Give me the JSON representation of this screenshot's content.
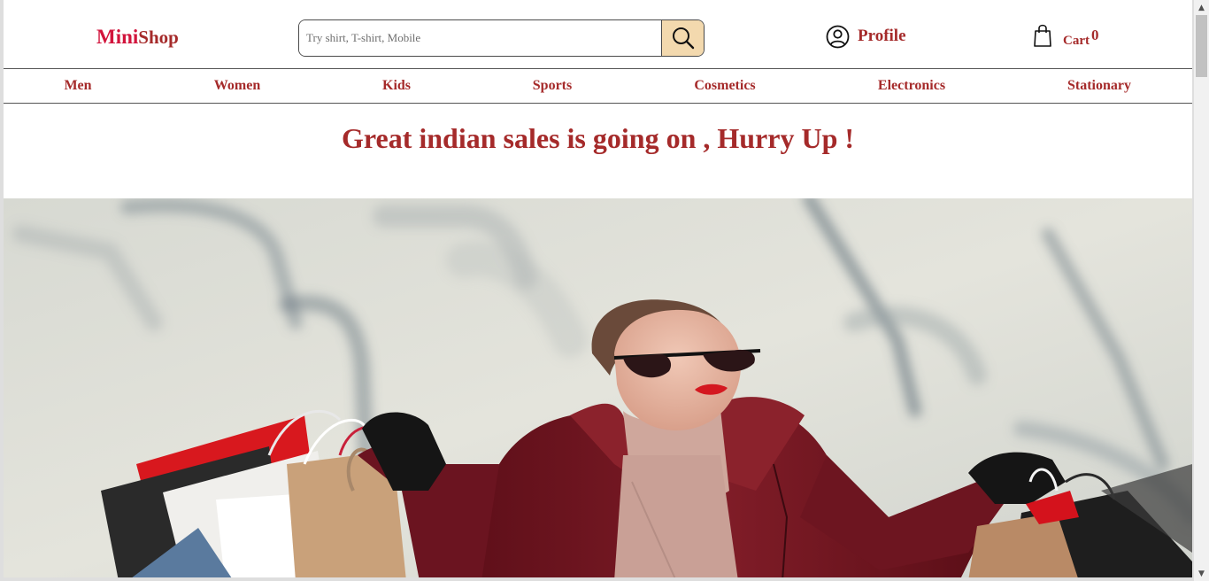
{
  "header": {
    "logo_first": "Mini",
    "logo_second": "Shop",
    "search_placeholder": "Try shirt, T-shirt, Mobile",
    "search_icon": "search-icon",
    "profile_label": "Profile",
    "profile_icon": "user-circle-icon",
    "cart_label": "Cart",
    "cart_count": "0",
    "cart_icon": "shopping-bag-icon"
  },
  "nav": {
    "items": [
      {
        "label": "Men"
      },
      {
        "label": "Women"
      },
      {
        "label": "Kids"
      },
      {
        "label": "Sports"
      },
      {
        "label": "Cosmetics"
      },
      {
        "label": "Electronics"
      },
      {
        "label": "Stationary"
      }
    ]
  },
  "banner": {
    "text": "Great indian sales is going on , Hurry Up !"
  },
  "colors": {
    "brand_red": "#d2143c",
    "accent_brown": "#a52a2a",
    "search_button": "#f3d9ae",
    "coat": "#7a1a22"
  }
}
